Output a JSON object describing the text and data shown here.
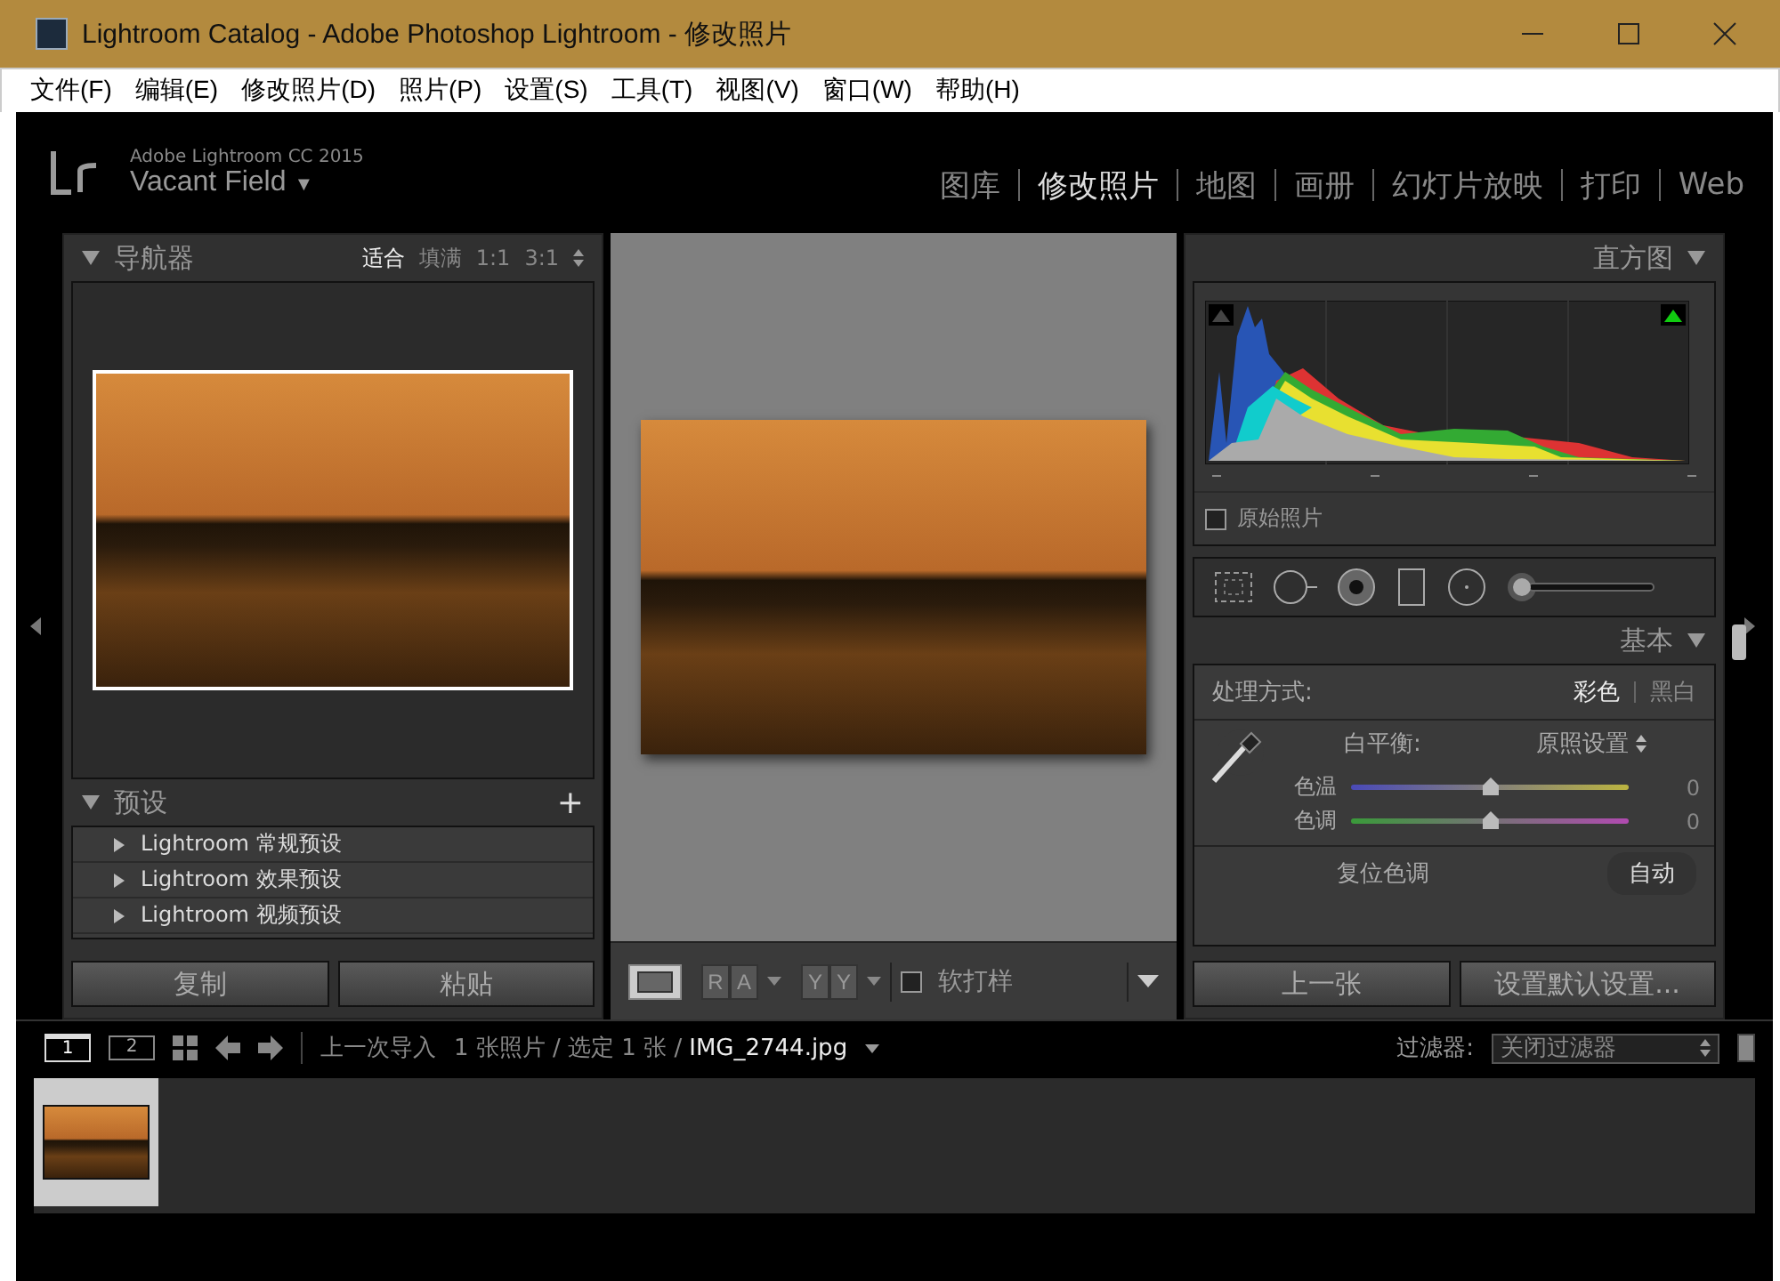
{
  "window": {
    "title": "Lightroom Catalog - Adobe Photoshop Lightroom - 修改照片"
  },
  "menu": [
    "文件(F)",
    "编辑(E)",
    "修改照片(D)",
    "照片(P)",
    "设置(S)",
    "工具(T)",
    "视图(V)",
    "窗口(W)",
    "帮助(H)"
  ],
  "identity": {
    "product": "Adobe Lightroom CC 2015",
    "name": "Vacant Field",
    "caret": "▼"
  },
  "modules": [
    {
      "label": "图库",
      "selected": false
    },
    {
      "label": "修改照片",
      "selected": true
    },
    {
      "label": "地图",
      "selected": false
    },
    {
      "label": "画册",
      "selected": false
    },
    {
      "label": "幻灯片放映",
      "selected": false
    },
    {
      "label": "打印",
      "selected": false
    },
    {
      "label": "Web",
      "selected": false
    }
  ],
  "navigator": {
    "title": "导航器",
    "zoom_options": [
      {
        "label": "适合",
        "selected": true
      },
      {
        "label": "填满",
        "selected": false
      },
      {
        "label": "1:1",
        "selected": false
      },
      {
        "label": "3:1",
        "selected": false
      }
    ]
  },
  "presets": {
    "title": "预设",
    "add": "+",
    "items": [
      {
        "label": "Lightroom 常规预设",
        "expanded": false
      },
      {
        "label": "Lightroom 效果预设",
        "expanded": false
      },
      {
        "label": "Lightroom 视频预设",
        "expanded": false
      }
    ]
  },
  "left_buttons": [
    "复制",
    "粘贴"
  ],
  "toolbar": {
    "pairs": [
      [
        "R",
        "A"
      ],
      [
        "Y",
        "Y"
      ]
    ],
    "soft_proof": {
      "label": "软打样",
      "checked": false
    }
  },
  "histogram": {
    "title": "直方图",
    "original_photo": {
      "label": "原始照片",
      "checked": false
    }
  },
  "basic": {
    "title": "基本",
    "treatment_label": "处理方式:",
    "treatments": [
      {
        "label": "彩色",
        "selected": true
      },
      {
        "label": "黑白",
        "selected": false
      }
    ],
    "wb_label": "白平衡:",
    "wb_value": "原照设置",
    "sliders": [
      {
        "name": "色温",
        "kind": "temp",
        "level": 0.5,
        "reading": "0"
      },
      {
        "name": "色调",
        "kind": "tint",
        "level": 0.5,
        "reading": "0"
      }
    ],
    "tone_label": "复位色调",
    "auto": "自动"
  },
  "right_buttons": [
    "上一张",
    "设置默认设置..."
  ],
  "filmstrip_bar": {
    "views": [
      {
        "label": "1",
        "selected": true
      },
      {
        "label": "2",
        "selected": false
      }
    ],
    "source": "上一次导入",
    "info": "1 张照片 / 选定 1 张 /",
    "filename": "IMG_2744.jpg",
    "filter_label": "过滤器:",
    "filter_value": "关闭过滤器"
  },
  "filmstrip": [
    {
      "selected": true
    }
  ]
}
